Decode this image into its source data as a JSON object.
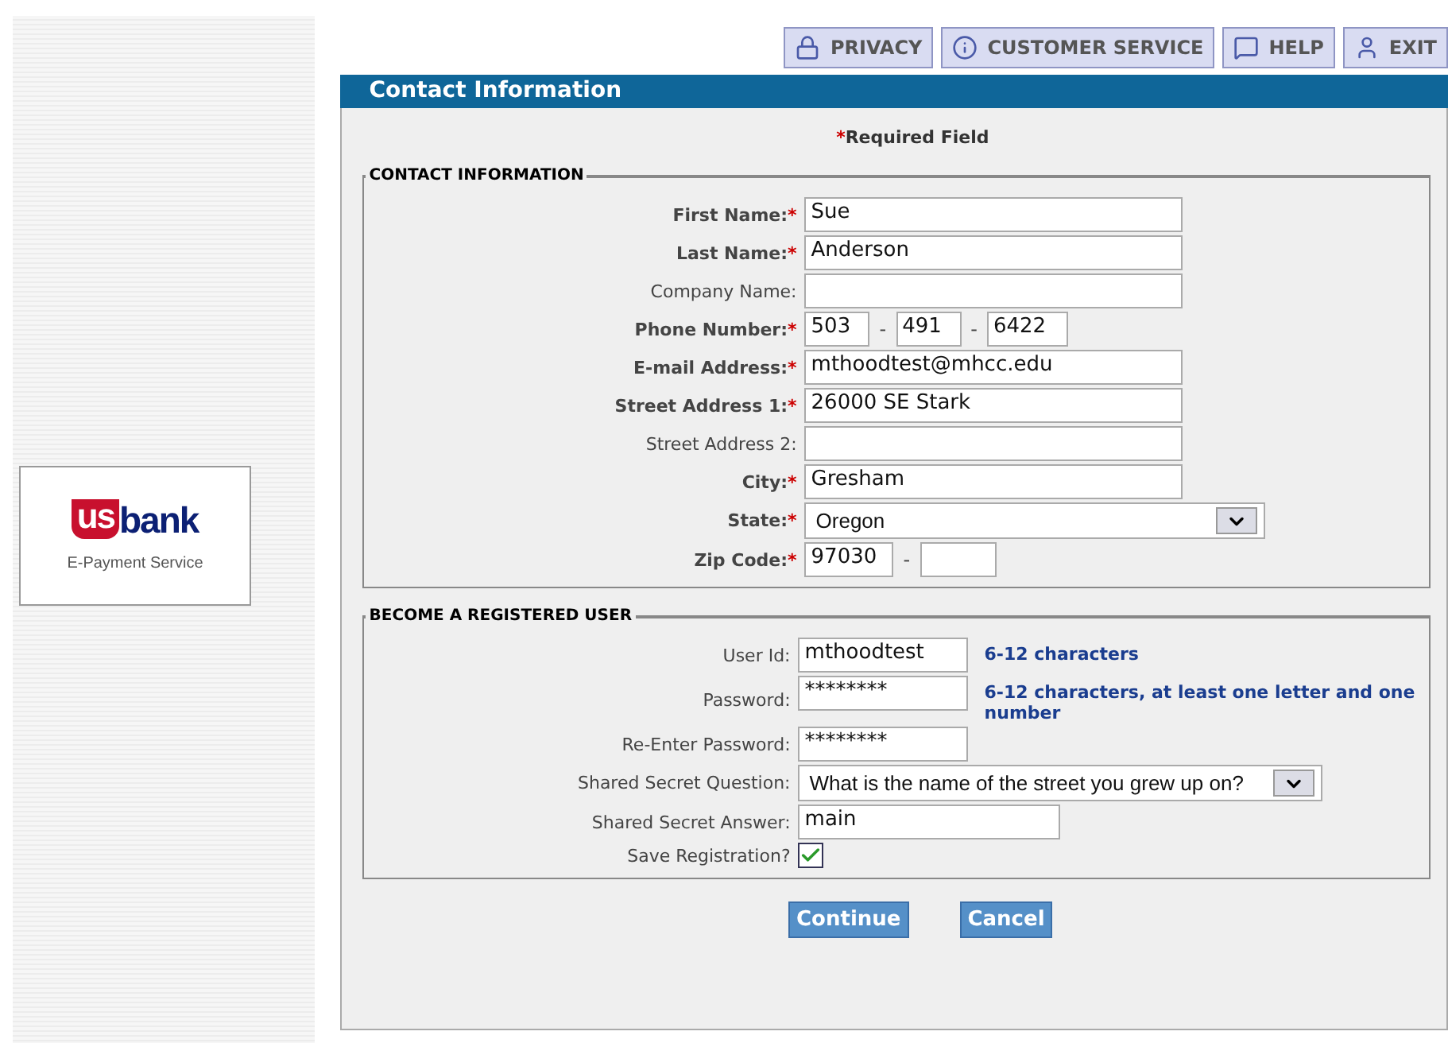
{
  "toolbar": [
    {
      "label": "PRIVACY",
      "kind": "lock"
    },
    {
      "label": "CUSTOMER SERVICE",
      "kind": "info"
    },
    {
      "label": "HELP",
      "kind": "help"
    },
    {
      "label": "EXIT",
      "kind": "exit"
    }
  ],
  "logo": {
    "mark": "us",
    "word": "bank",
    "tagline": "E-Payment Service"
  },
  "header": {
    "title": "Contact Information"
  },
  "required_note": {
    "mark": "*",
    "text": "Required Field"
  },
  "contact": {
    "legend": "CONTACT INFORMATION",
    "fields": [
      {
        "label": "First Name:",
        "required_mark": "*",
        "kind": "text",
        "value": "Sue"
      },
      {
        "label": "Last Name:",
        "required_mark": "*",
        "kind": "text",
        "value": "Anderson"
      },
      {
        "label": "Company Name:",
        "kind": "text"
      },
      {
        "label": "Phone Number:",
        "required_mark": "*",
        "kind": "phone",
        "parts": [
          "503",
          "491",
          "6422"
        ],
        "separator": "-"
      },
      {
        "label": "E-mail Address:",
        "required_mark": "*",
        "kind": "text",
        "value": "mthoodtest@mhcc.edu"
      },
      {
        "label": "Street Address 1:",
        "required_mark": "*",
        "kind": "text",
        "value": "26000 SE Stark"
      },
      {
        "label": "Street Address 2:",
        "kind": "text"
      },
      {
        "label": "City:",
        "required_mark": "*",
        "kind": "text",
        "value": "Gresham"
      },
      {
        "label": "State:",
        "required_mark": "*",
        "kind": "select",
        "value": "Oregon"
      },
      {
        "label": "Zip Code:",
        "required_mark": "*",
        "kind": "zip",
        "parts": [
          "97030"
        ],
        "separator": "-"
      }
    ]
  },
  "registration": {
    "legend": "BECOME A REGISTERED USER",
    "fields": [
      {
        "label": "User Id:",
        "kind": "short",
        "value": "mthoodtest",
        "hint": "6-12 characters"
      },
      {
        "label": "Password:",
        "kind": "short",
        "value": "********",
        "hint": "6-12 characters, at least one letter and one number"
      },
      {
        "label": "Re-Enter Password:",
        "kind": "short",
        "value": "********"
      },
      {
        "label": "Shared Secret Question:",
        "kind": "question",
        "value": "What is the name of the street you grew up on?"
      },
      {
        "label": "Shared Secret Answer:",
        "kind": "answer",
        "value": "main"
      },
      {
        "label": "Save Registration?",
        "kind": "checkbox",
        "checked": true
      }
    ]
  },
  "buttons": [
    "Continue",
    "Cancel"
  ]
}
